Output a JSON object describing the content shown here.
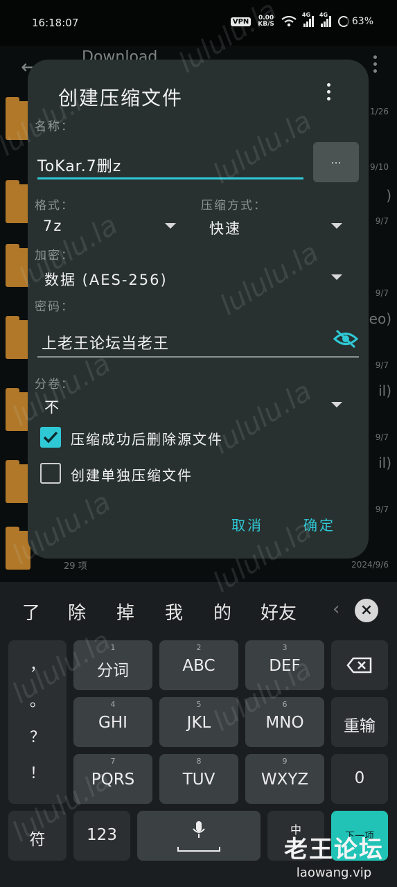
{
  "status_bar": {
    "time": "16:18:07",
    "vpn": "VPN",
    "speed_value": "0.00",
    "speed_unit": "KB/S",
    "sig1_tag": "4G",
    "sig2_tag": "4G",
    "battery": "63%"
  },
  "background_app": {
    "title": "Download",
    "dates": [
      "1/26",
      "9/10",
      "9/7",
      "9/7",
      "9/7",
      "9/7",
      "9/7"
    ],
    "right_texts": [
      ")",
      "eo)",
      "il)",
      "il)"
    ],
    "count": "29 项",
    "last_date": "2024/9/6"
  },
  "dialog": {
    "title": "创建压缩文件",
    "name_label": "名称：",
    "name_value": "ToKar.7删z",
    "browse_label": "...",
    "format_label": "格式：",
    "format_value": "7z",
    "method_label": "压缩方式：",
    "method_value": "快速",
    "encrypt_label": "加密：",
    "encrypt_value": "数据 (AES-256)",
    "password_label": "密码：",
    "password_value": "上老王论坛当老王",
    "split_label": "分卷：",
    "split_value": "不",
    "delete_source_label": "压缩成功后删除源文件",
    "delete_source_checked": true,
    "separate_label": "创建单独压缩文件",
    "separate_checked": false,
    "cancel_label": "取消",
    "ok_label": "确定"
  },
  "keyboard": {
    "candidates": [
      "了",
      "除",
      "掉",
      "我",
      "的",
      "好友",
      "‹"
    ],
    "punct": [
      "，",
      "。",
      "？",
      "！"
    ],
    "rows": [
      [
        {
          "num": "1",
          "label": "分词"
        },
        {
          "num": "2",
          "label": "ABC"
        },
        {
          "num": "3",
          "label": "DEF"
        }
      ],
      [
        {
          "num": "4",
          "label": "GHI"
        },
        {
          "num": "5",
          "label": "JKL"
        },
        {
          "num": "6",
          "label": "MNO"
        }
      ],
      [
        {
          "num": "7",
          "label": "PQRS"
        },
        {
          "num": "8",
          "label": "TUV"
        },
        {
          "num": "9",
          "label": "WXYZ"
        }
      ]
    ],
    "reinput_label": "重输",
    "zero_label": "0",
    "symbol_label": "符",
    "num_label": "123",
    "lang_label": "中",
    "enter_label": "下一项"
  },
  "watermark": {
    "text": "lululu.la",
    "logo_cn": "老王论坛",
    "logo_en": "laowang.vip"
  },
  "colors": {
    "accent": "#2fc9d6",
    "dialog_bg": "#283130",
    "enter_key": "#21c3b6"
  }
}
